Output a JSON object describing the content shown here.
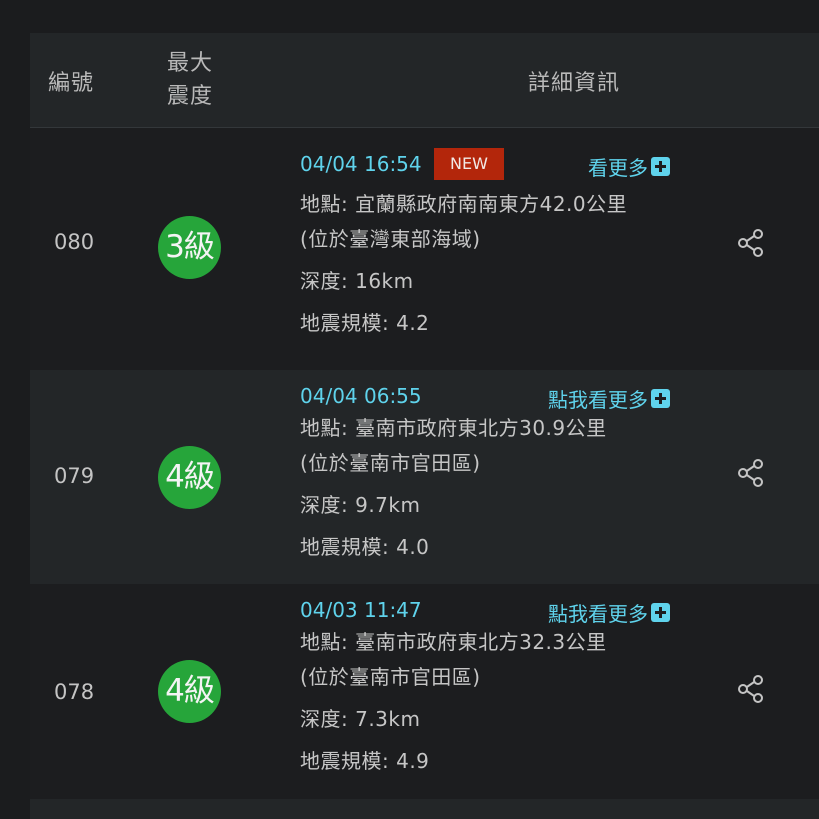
{
  "header": {
    "col_no": "編號",
    "col_intensity_1": "最大",
    "col_intensity_2": "震度",
    "col_detail": "詳細資訊"
  },
  "rows": [
    {
      "no": "080",
      "intensity": "3級",
      "time": "04/04 16:54",
      "badge": "NEW",
      "more": "看更多",
      "location_1": "地點: 宜蘭縣政府南南東方42.0公里",
      "location_2": "(位於臺灣東部海域)",
      "depth": "深度: 16km",
      "magnitude": "地震規模: 4.2"
    },
    {
      "no": "079",
      "intensity": "4級",
      "time": "04/04 06:55",
      "more": "點我看更多",
      "location_1": "地點: 臺南市政府東北方30.9公里",
      "location_2": "(位於臺南市官田區)",
      "depth": "深度: 9.7km",
      "magnitude": "地震規模: 4.0"
    },
    {
      "no": "078",
      "intensity": "4級",
      "time": "04/03 11:47",
      "more": "點我看更多",
      "location_1": "地點: 臺南市政府東北方32.3公里",
      "location_2": "(位於臺南市官田區)",
      "depth": "深度: 7.3km",
      "magnitude": "地震規模: 4.9"
    }
  ],
  "colors": {
    "accent": "#5fd3ec",
    "intensity_badge": "#26a53a",
    "new_badge": "#b3260b"
  }
}
